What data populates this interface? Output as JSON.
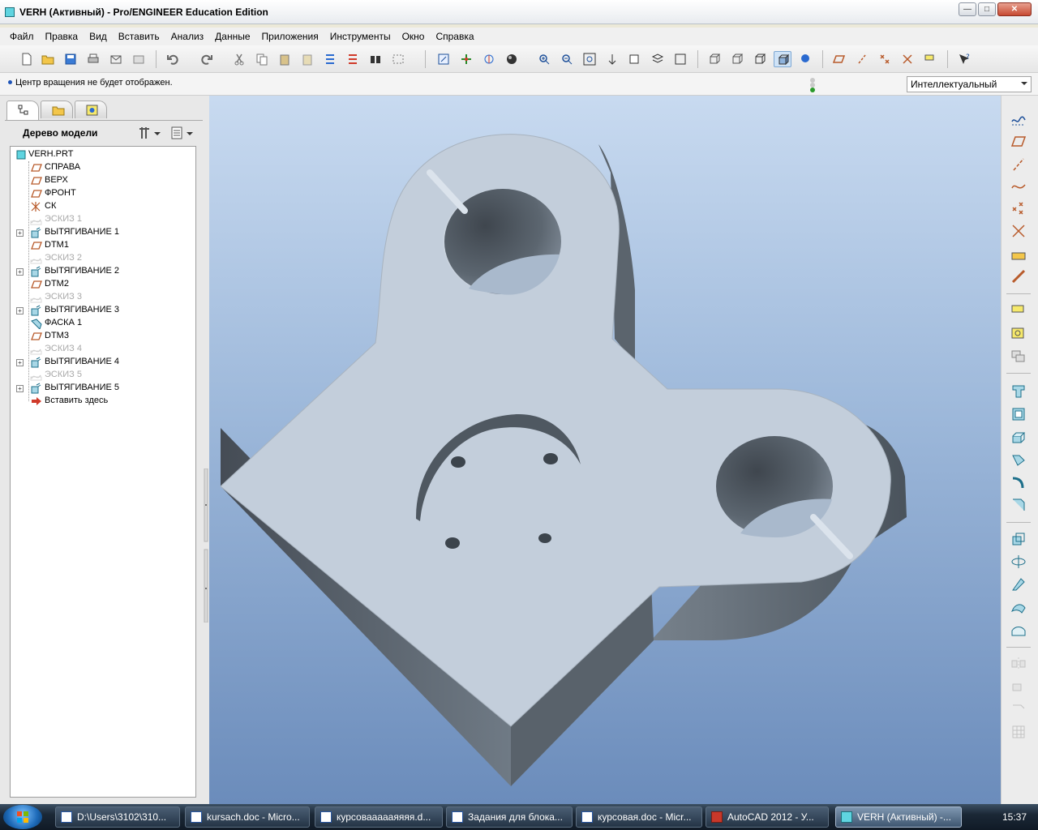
{
  "window": {
    "title": "VERH (Активный) - Pro/ENGINEER Education Edition",
    "min_label": "—",
    "max_label": "□",
    "close_label": "✕"
  },
  "menu": [
    "Файл",
    "Правка",
    "Вид",
    "Вставить",
    "Анализ",
    "Данные",
    "Приложения",
    "Инструменты",
    "Окно",
    "Справка"
  ],
  "message": {
    "text": "Центр вращения не будет отображен."
  },
  "filter": {
    "value": "Интеллектуальный"
  },
  "model_tree": {
    "title": "Дерево модели",
    "items": [
      {
        "label": "VERH.PRT",
        "icon": "part-icon",
        "expandable": false,
        "dim": false
      },
      {
        "label": "СПРАВА",
        "icon": "datum-plane-icon",
        "expandable": false,
        "dim": false
      },
      {
        "label": "ВЕРХ",
        "icon": "datum-plane-icon",
        "expandable": false,
        "dim": false
      },
      {
        "label": "ФРОНТ",
        "icon": "datum-plane-icon",
        "expandable": false,
        "dim": false
      },
      {
        "label": "СК",
        "icon": "coordinate-system-icon",
        "expandable": false,
        "dim": false
      },
      {
        "label": "ЭСКИЗ 1",
        "icon": "sketch-icon",
        "expandable": false,
        "dim": true
      },
      {
        "label": "ВЫТЯГИВАНИЕ 1",
        "icon": "extrude-icon",
        "expandable": true,
        "dim": false
      },
      {
        "label": "DTM1",
        "icon": "datum-plane-icon",
        "expandable": false,
        "dim": false
      },
      {
        "label": "ЭСКИЗ 2",
        "icon": "sketch-icon",
        "expandable": false,
        "dim": true
      },
      {
        "label": "ВЫТЯГИВАНИЕ 2",
        "icon": "extrude-icon",
        "expandable": true,
        "dim": false
      },
      {
        "label": "DTM2",
        "icon": "datum-plane-icon",
        "expandable": false,
        "dim": false
      },
      {
        "label": "ЭСКИЗ 3",
        "icon": "sketch-icon",
        "expandable": false,
        "dim": true
      },
      {
        "label": "ВЫТЯГИВАНИЕ 3",
        "icon": "extrude-icon",
        "expandable": true,
        "dim": false
      },
      {
        "label": "ФАСКА 1",
        "icon": "chamfer-icon",
        "expandable": false,
        "dim": false
      },
      {
        "label": "DTM3",
        "icon": "datum-plane-icon",
        "expandable": false,
        "dim": false
      },
      {
        "label": "ЭСКИЗ 4",
        "icon": "sketch-icon",
        "expandable": false,
        "dim": true
      },
      {
        "label": "ВЫТЯГИВАНИЕ 4",
        "icon": "extrude-icon",
        "expandable": true,
        "dim": false
      },
      {
        "label": "ЭСКИЗ 5",
        "icon": "sketch-icon",
        "expandable": false,
        "dim": true
      },
      {
        "label": "ВЫТЯГИВАНИЕ 5",
        "icon": "extrude-icon",
        "expandable": true,
        "dim": false
      },
      {
        "label": "Вставить здесь",
        "icon": "insert-here-arrow-icon",
        "expandable": false,
        "dim": false
      }
    ]
  },
  "taskbar": {
    "tasks": [
      {
        "label": "D:\\Users\\3102\\310...",
        "icon": "folder-icon",
        "active": false
      },
      {
        "label": "kursach.doc - Micro...",
        "icon": "word-icon",
        "active": false
      },
      {
        "label": "курсоваааааяяяя.d...",
        "icon": "word-icon",
        "active": false
      },
      {
        "label": "Задания для блока...",
        "icon": "word-icon",
        "active": false
      },
      {
        "label": "курсовая.doc - Micr...",
        "icon": "word-icon",
        "active": false
      },
      {
        "label": "AutoCAD 2012 - У...",
        "icon": "autocad-icon",
        "active": false
      },
      {
        "label": "VERH (Активный) -...",
        "icon": "proe-icon",
        "active": true
      }
    ],
    "clock": "15:37"
  },
  "colors": {
    "viewport_top": "#c8daf0",
    "viewport_bottom": "#6b8cbb",
    "part_face": "#c5d1dd",
    "part_side": "#5f6a76"
  }
}
